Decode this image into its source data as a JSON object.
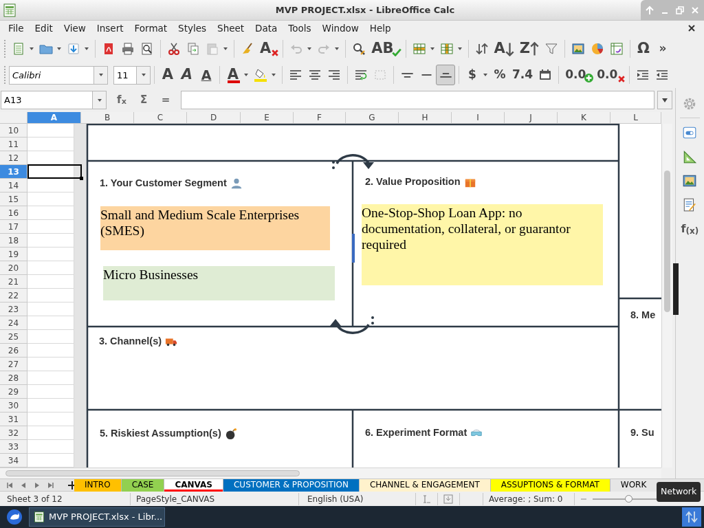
{
  "window": {
    "title": "MVP PROJECT.xlsx - LibreOffice Calc"
  },
  "menu": [
    "File",
    "Edit",
    "View",
    "Insert",
    "Format",
    "Styles",
    "Sheet",
    "Data",
    "Tools",
    "Window",
    "Help"
  ],
  "standard_toolbar": [
    {
      "disabled": false,
      "menu": true
    },
    {
      "disabled": false,
      "menu": true
    },
    {
      "disabled": false,
      "menu": true
    },
    {
      "disabled": false,
      "menu": false
    },
    {
      "disabled": false,
      "menu": false
    },
    {
      "disabled": false,
      "menu": false
    },
    {
      "disabled": false,
      "menu": false
    },
    {
      "disabled": false,
      "menu": false
    },
    {
      "disabled": true,
      "menu": true
    },
    {
      "disabled": false,
      "menu": false
    },
    {
      "text": "A",
      "disabled": false,
      "menu": false
    },
    {
      "disabled": true,
      "menu": true
    },
    {
      "disabled": true,
      "menu": true
    },
    {
      "disabled": false,
      "menu": false
    },
    {
      "text": "AB",
      "disabled": false,
      "menu": false
    },
    {
      "disabled": false,
      "menu": true
    },
    {
      "disabled": false,
      "menu": true
    },
    {
      "disabled": false,
      "menu": false
    },
    {
      "text": "A",
      "disabled": false,
      "menu": false
    },
    {
      "text": "Z",
      "disabled": false,
      "menu": false
    },
    {
      "disabled": false,
      "menu": false
    },
    {
      "disabled": false,
      "menu": false
    },
    {
      "disabled": false,
      "menu": false
    },
    {
      "disabled": false,
      "menu": false
    },
    {
      "text": "Ω",
      "disabled": false,
      "menu": false
    },
    {
      "text": "»",
      "disabled": false,
      "menu": false
    }
  ],
  "formatting_toolbar": {
    "font_name": "Calibri",
    "font_size": "11",
    "items": [
      {
        "text": "A",
        "disabled": false,
        "menu": false,
        "pressed": false
      },
      {
        "text": "A",
        "disabled": false,
        "menu": false,
        "pressed": false
      },
      {
        "text": "A",
        "disabled": false,
        "menu": false,
        "pressed": false
      },
      {
        "text": "A",
        "disabled": false,
        "menu": true,
        "pressed": false
      },
      {
        "disabled": false,
        "menu": true,
        "pressed": false
      },
      {
        "disabled": false,
        "menu": false,
        "pressed": false
      },
      {
        "disabled": false,
        "menu": false,
        "pressed": false
      },
      {
        "disabled": false,
        "menu": false,
        "pressed": false
      },
      {
        "disabled": false,
        "menu": false,
        "pressed": false
      },
      {
        "disabled": true,
        "menu": false,
        "pressed": false
      },
      {
        "disabled": false,
        "menu": false,
        "pressed": false
      },
      {
        "disabled": false,
        "menu": false,
        "pressed": false
      },
      {
        "disabled": false,
        "menu": false,
        "pressed": true
      },
      {
        "text": "$",
        "disabled": false,
        "menu": true,
        "pressed": false
      },
      {
        "text": "%",
        "disabled": false,
        "menu": false,
        "pressed": false
      },
      {
        "text": "7.4",
        "disabled": false,
        "menu": false,
        "pressed": false
      },
      {
        "disabled": false,
        "menu": false,
        "pressed": false
      },
      {
        "text": "0.0",
        "disabled": false,
        "menu": false,
        "pressed": false
      },
      {
        "text": "0.0",
        "disabled": false,
        "menu": false,
        "pressed": false
      },
      {
        "disabled": false,
        "menu": false,
        "pressed": false
      },
      {
        "disabled": false,
        "menu": false,
        "pressed": false
      }
    ]
  },
  "formula_bar": {
    "cell_ref": "A13",
    "buttons": [
      "f$_{x}$",
      "Σ",
      "="
    ]
  },
  "columns": [
    {
      "label": "A",
      "selected": true
    },
    {
      "label": "B",
      "selected": false
    },
    {
      "label": "C",
      "selected": false
    },
    {
      "label": "D",
      "selected": false
    },
    {
      "label": "E",
      "selected": false
    },
    {
      "label": "F",
      "selected": false
    },
    {
      "label": "G",
      "selected": false
    },
    {
      "label": "H",
      "selected": false
    },
    {
      "label": "I",
      "selected": false
    },
    {
      "label": "J",
      "selected": false
    },
    {
      "label": "K",
      "selected": false
    },
    {
      "label": "L",
      "selected": false
    }
  ],
  "rows": [
    {
      "label": "10",
      "selected": false
    },
    {
      "label": "11",
      "selected": false
    },
    {
      "label": "12",
      "selected": false
    },
    {
      "label": "13",
      "selected": true
    },
    {
      "label": "14",
      "selected": false
    },
    {
      "label": "15",
      "selected": false
    },
    {
      "label": "16",
      "selected": false
    },
    {
      "label": "17",
      "selected": false
    },
    {
      "label": "18",
      "selected": false
    },
    {
      "label": "19",
      "selected": false
    },
    {
      "label": "20",
      "selected": false
    },
    {
      "label": "21",
      "selected": false
    },
    {
      "label": "22",
      "selected": false
    },
    {
      "label": "23",
      "selected": false
    },
    {
      "label": "24",
      "selected": false
    },
    {
      "label": "25",
      "selected": false
    },
    {
      "label": "26",
      "selected": false
    },
    {
      "label": "27",
      "selected": false
    },
    {
      "label": "28",
      "selected": false
    },
    {
      "label": "29",
      "selected": false
    },
    {
      "label": "30",
      "selected": false
    },
    {
      "label": "31",
      "selected": false
    },
    {
      "label": "32",
      "selected": false
    },
    {
      "label": "33",
      "selected": false
    },
    {
      "label": "34",
      "selected": false
    }
  ],
  "canvas": {
    "sections": [
      {
        "title": "1. Your Customer Segment"
      },
      {
        "title": "2. Value Proposition"
      },
      {
        "title": "3. Channel(s)"
      },
      {
        "title": "5. Riskiest Assumption(s)"
      },
      {
        "title": "6. Experiment Format"
      },
      {
        "title": "8. Me"
      },
      {
        "title": "9. Su"
      }
    ],
    "notes": [
      {
        "text": "Small and Medium Scale Enterprises (SMES)",
        "color": "#fdd5a0"
      },
      {
        "text": "Micro Businesses",
        "color": "#dfecd4"
      },
      {
        "text": "One-Stop-Shop Loan App: no documentation, collateral, or guarantor required",
        "color": "#fff6a8"
      }
    ]
  },
  "sidebar": {
    "functions_label": "f$_{(x)}$"
  },
  "sheet_tabs": [
    {
      "label": "INTRO",
      "color": "#ffc000",
      "selected": false
    },
    {
      "label": "CASE",
      "color": "#92d050",
      "selected": false
    },
    {
      "label": "CANVAS",
      "color": "#ff0000",
      "selected": true
    },
    {
      "label": "CUSTOMER & PROPOSITION",
      "color": "#0070c0",
      "selected": false
    },
    {
      "label": "CHANNEL & ENGAGEMENT",
      "color": "#fff2cc",
      "selected": false
    },
    {
      "label": "ASSUPTIONS & FORMAT",
      "color": "#ffff00",
      "selected": false
    },
    {
      "label": "WORK",
      "color": "#e6e6e6",
      "selected": false
    }
  ],
  "status_bar": {
    "sheet": "Sheet 3 of 12",
    "page_style": "PageStyle_CANVAS",
    "language": "English (USA)",
    "selection_summary": "Average: ; Sum: 0",
    "zoom": {
      "level": 0.5
    }
  },
  "tooltip": "Network",
  "taskbar": {
    "tasks": [
      {
        "label": "MVP PROJECT.xlsx - Libr...",
        "selected": true
      }
    ]
  }
}
